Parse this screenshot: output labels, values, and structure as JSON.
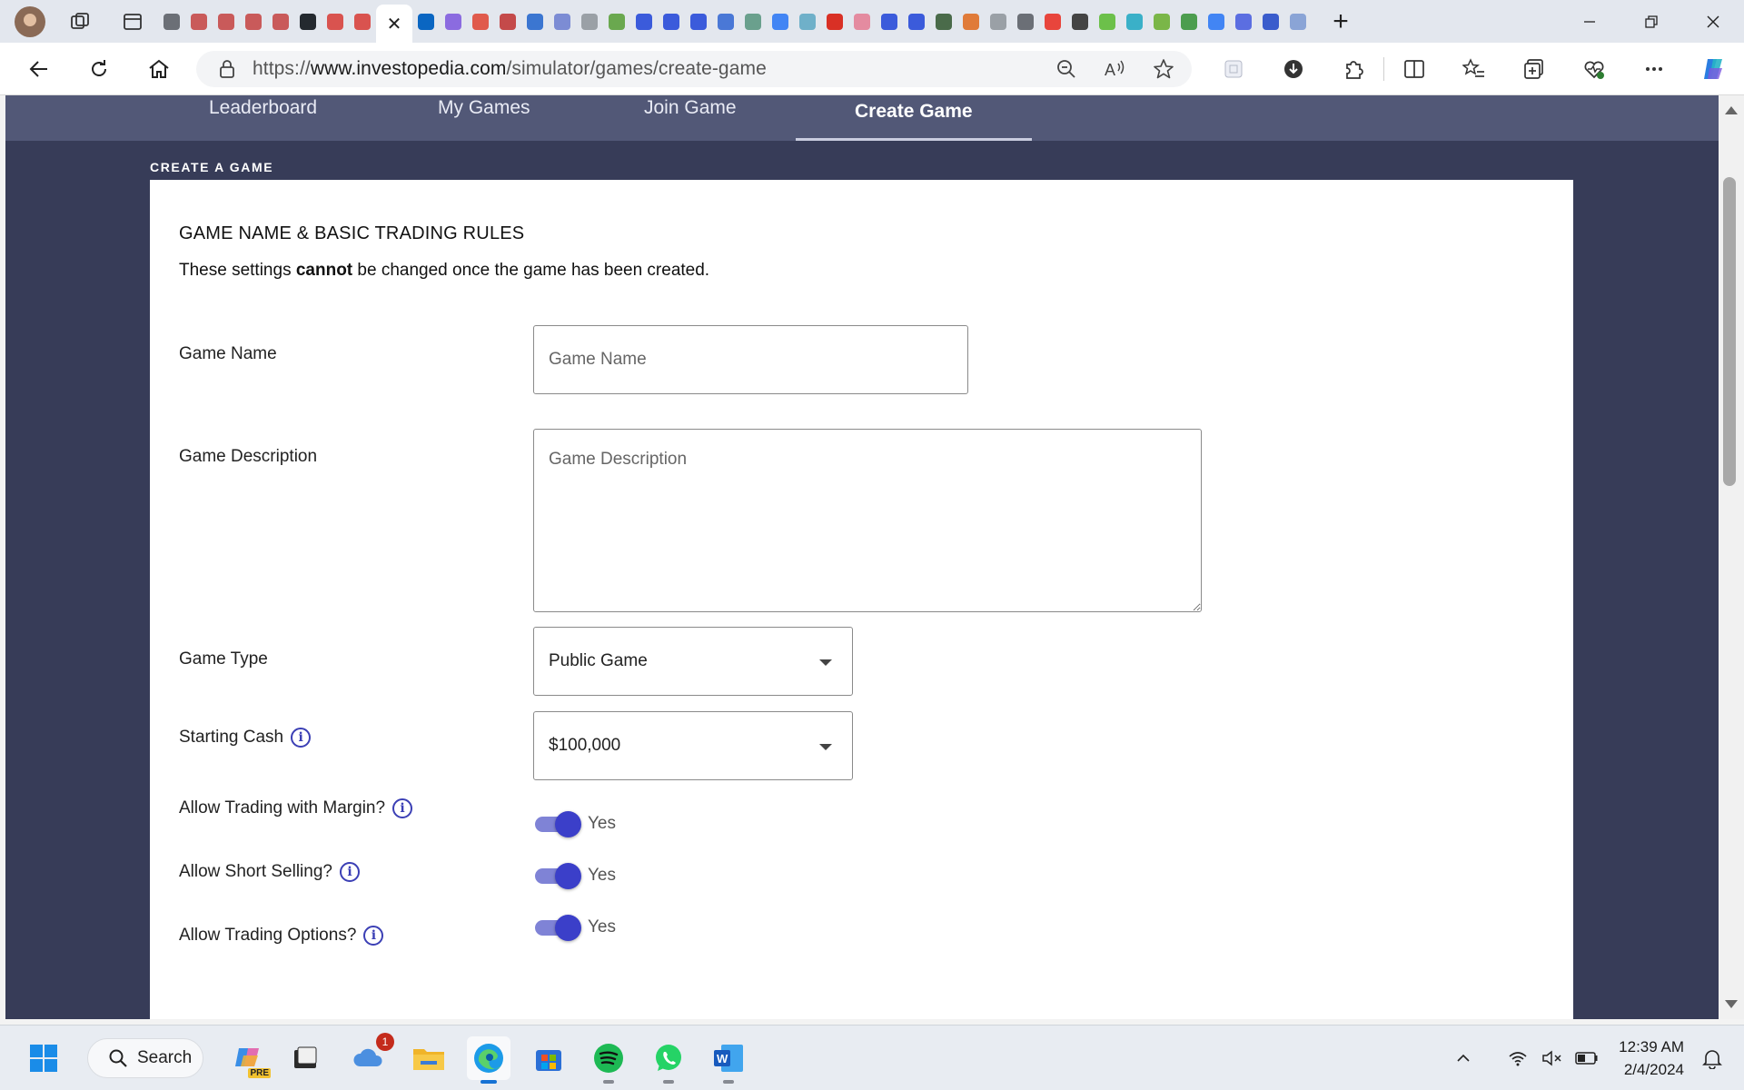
{
  "browser": {
    "url_prefix": "https://",
    "url_host": "www.investopedia.com",
    "url_path": "/simulator/games/create-game",
    "active_tab_close": "✕",
    "new_tab": "+",
    "tab_favicon_colors": [
      "#6b6f76",
      "#c95a5a",
      "#c95a5a",
      "#c95a5a",
      "#c95a5a",
      "#24292f",
      "#d9534f",
      "#d9534f",
      "#0a66c2",
      "#8b6be0",
      "#e05a4c",
      "#c44a4a",
      "#3b76d1",
      "#7c8cd4",
      "#9aa0a6",
      "#6aa84f",
      "#3b5bdb",
      "#3b5bdb",
      "#3b5bdb",
      "#4a78d6",
      "#6aa08d",
      "#4285f4",
      "#6fb0c9",
      "#d93025",
      "#e48ba0",
      "#3b5bdb",
      "#3b5bdb",
      "#4a6b4a",
      "#e07b39",
      "#9aa0a6",
      "#6b6f76",
      "#e8453c",
      "#444",
      "#6cc04a",
      "#3ab0c8",
      "#7ab648",
      "#4c9d4e",
      "#4285f4",
      "#5b6ee1",
      "#3a5ccc",
      "#8aa4d6"
    ]
  },
  "site_nav": {
    "items": [
      "Leaderboard",
      "My Games",
      "Join Game",
      "Create Game"
    ],
    "active": "Create Game"
  },
  "page": {
    "section_label": "CREATE A GAME",
    "heading": "GAME NAME & BASIC TRADING RULES",
    "note_before": "These settings ",
    "note_bold": "cannot",
    "note_after": " be changed once the game has been created."
  },
  "form": {
    "game_name_label": "Game Name",
    "game_name_placeholder": "Game Name",
    "game_name_value": "",
    "game_description_label": "Game Description",
    "game_description_placeholder": "Game Description",
    "game_type_label": "Game Type",
    "game_type_value": "Public Game",
    "starting_cash_label": "Starting Cash",
    "starting_cash_value": "$100,000",
    "margin_label": "Allow Trading with Margin?",
    "margin_value": "Yes",
    "short_label": "Allow Short Selling?",
    "short_value": "Yes",
    "options_label": "Allow Trading Options?",
    "options_value": "Yes",
    "accent_color": "#3b3fc9"
  },
  "taskbar": {
    "search_label": "Search",
    "notification_count": "1",
    "time": "12:39 AM",
    "date": "2/4/2024",
    "copilot_pre_badge": "PRE"
  }
}
